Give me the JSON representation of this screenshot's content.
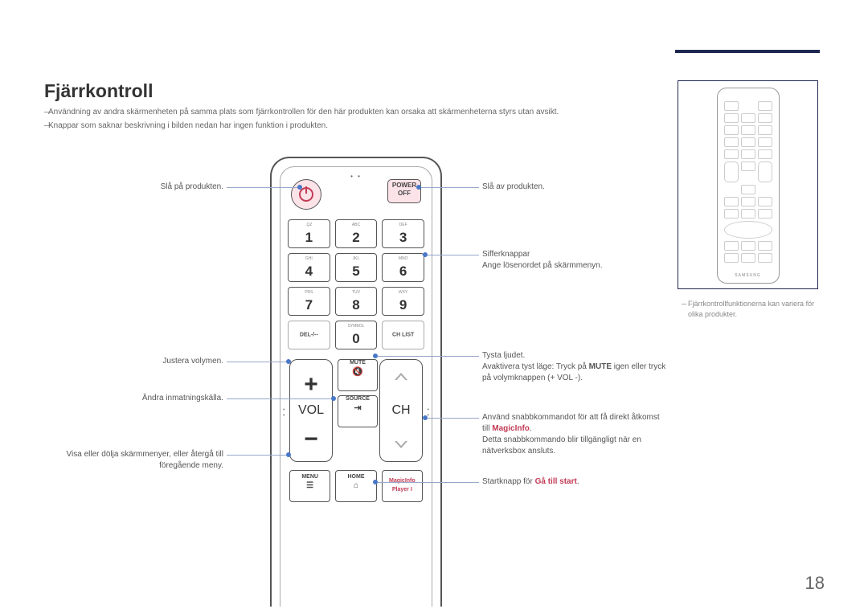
{
  "title": "Fjärrkontroll",
  "notes": [
    "Användning av andra skärmenheten på samma plats som fjärrkontrollen för den här produkten kan orsaka att skärmenheterna styrs utan avsikt.",
    "Knappar som saknar beskrivning i bilden nedan har ingen funktion i produkten."
  ],
  "remote": {
    "power_off": {
      "line1": "POWER",
      "line2": "OFF"
    },
    "keys": [
      {
        "sub": ".QZ",
        "num": "1"
      },
      {
        "sub": "ABC",
        "num": "2"
      },
      {
        "sub": "DEF",
        "num": "3"
      },
      {
        "sub": "GHI",
        "num": "4"
      },
      {
        "sub": "JKL",
        "num": "5"
      },
      {
        "sub": "MNO",
        "num": "6"
      },
      {
        "sub": "PRS",
        "num": "7"
      },
      {
        "sub": "TUV",
        "num": "8"
      },
      {
        "sub": "WXY",
        "num": "9"
      }
    ],
    "row4": {
      "del": "DEL-/--",
      "symbol": "SYMBOL",
      "zero": "0",
      "chlist": "CH LIST"
    },
    "vol_label": "VOL",
    "ch_label": "CH",
    "mute": "MUTE",
    "source": "SOURCE",
    "menu": "MENU",
    "home": "HOME",
    "magicinfo": {
      "line1": "MagicInfo",
      "line2": "Player I"
    }
  },
  "callouts": {
    "left": {
      "power_on": "Slå på produkten.",
      "volume": "Justera volymen.",
      "source": "Ändra inmatningskälla.",
      "menu": "Visa eller dölja skärmmenyer, eller återgå till föregående meny."
    },
    "right": {
      "power_off": "Slå av produkten.",
      "digits_1": "Sifferknappar",
      "digits_2": "Ange lösenordet på skärmmenyn.",
      "mute_1": "Tysta ljudet.",
      "mute_2a": "Avaktivera tyst läge: Tryck på ",
      "mute_2b": "MUTE",
      "mute_2c": " igen eller tryck på volymknappen (+ VOL -).",
      "magic_1a": "Använd snabbkommandot för att få direkt åtkomst till ",
      "magic_1b": "MagicInfo",
      "magic_1c": ".",
      "magic_2": "Detta snabbkommando blir tillgängligt när en nätverksbox ansluts.",
      "home_a": "Startknapp för ",
      "home_b": "Gå till start",
      "home_c": "."
    }
  },
  "mini_samsung": "SAMSUNG",
  "mini_note": "Fjärrkontrollfunktionerna kan variera för olika produkter.",
  "page_number": "18"
}
